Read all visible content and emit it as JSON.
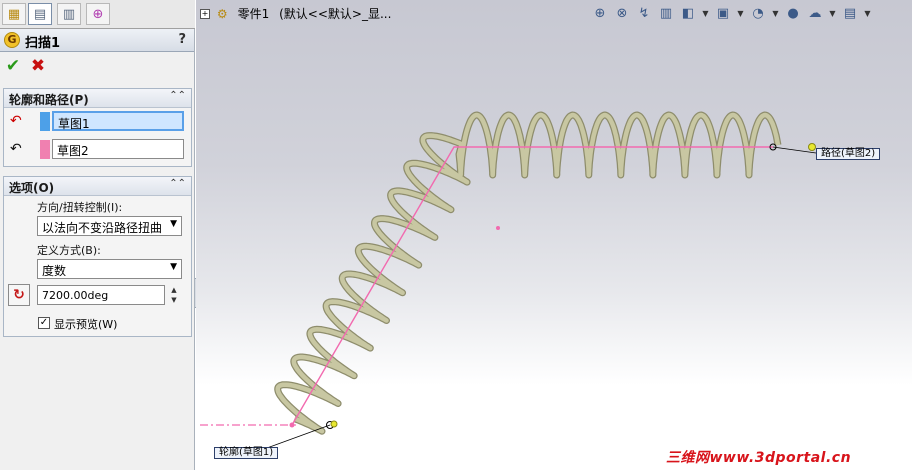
{
  "panel": {
    "tabs": [
      "property-manager",
      "feature-manager",
      "configuration-manager",
      "dim-xpert-manager"
    ],
    "feature_title": "扫描1",
    "help": "?",
    "ok_icon": "✔",
    "cancel_icon": "✖",
    "profile_path_group": {
      "title": "轮廓和路径(P)",
      "profile_value": "草图1",
      "path_value": "草图2",
      "profile_color": "#4da0e8",
      "path_color": "#f080b0"
    },
    "options_group": {
      "title": "选项(O)",
      "orientation_label": "方向/扭转控制(I):",
      "orientation_value": "以法向不变沿路径扭曲",
      "define_label": "定义方式(B):",
      "define_value": "度数",
      "angle_value": "7200.00deg",
      "preview_label": "显示预览(W)",
      "preview_checked": true
    }
  },
  "graphics": {
    "part_name": "零件1",
    "config_text": "(默认<<默认>_显...",
    "view_toolbar": [
      "zoom-fit-icon",
      "zoom-area-icon",
      "previous-view-icon",
      "section-view-icon",
      "view-orientation-icon",
      "display-style-icon",
      "hide-show-icon",
      "edit-appearance-icon",
      "apply-scene-icon",
      "view-settings-icon"
    ],
    "path_callout": "路径(草图2)",
    "profile_callout": "轮廓(草图1)",
    "watermark": "三维网www.3dportal.cn",
    "spring_color": "#c8c7a2",
    "path_line_color": "#f26aaf"
  }
}
